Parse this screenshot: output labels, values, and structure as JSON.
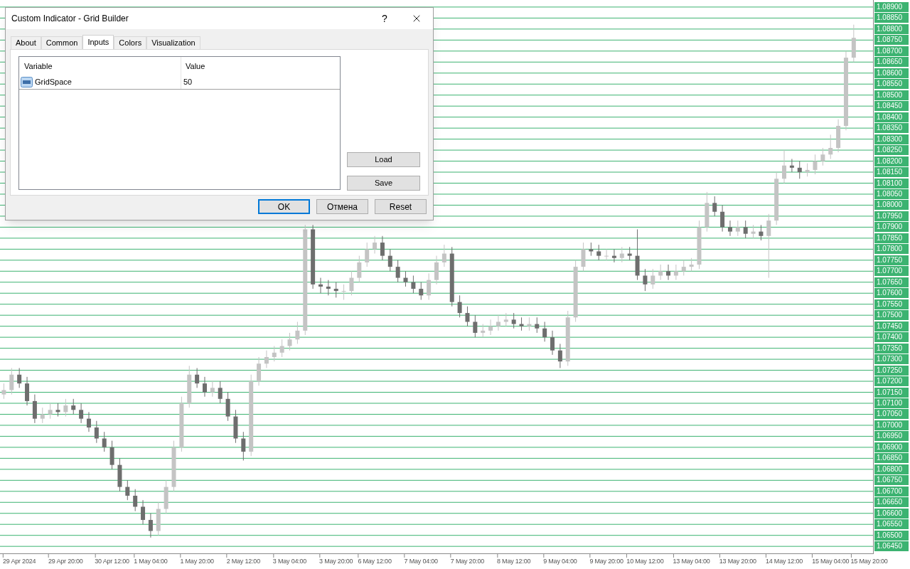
{
  "chart": {
    "chart_data": {
      "type": "candlestick",
      "grid": true,
      "ylim": [
        1.06415,
        1.08932
      ],
      "categories": [
        null,
        null,
        "29 Apr 2024",
        null,
        null,
        null,
        null,
        null,
        "29 Apr 20:00",
        null,
        null,
        null,
        null,
        null,
        "30 Apr 12:00",
        null,
        null,
        null,
        null,
        "1 May 04:00",
        null,
        null,
        null,
        null,
        null,
        "1 May 20:00",
        null,
        null,
        null,
        null,
        null,
        "2 May 12:00",
        null,
        null,
        null,
        null,
        null,
        "3 May 04:00",
        null,
        null,
        null,
        null,
        null,
        "3 May 20:00",
        null,
        null,
        null,
        null,
        "6 May 12:00",
        null,
        null,
        null,
        null,
        null,
        "7 May 04:00",
        null,
        null,
        null,
        null,
        null,
        "7 May 20:00",
        null,
        null,
        null,
        null,
        null,
        "8 May 12:00",
        null,
        null,
        null,
        null,
        null,
        "9 May 04:00",
        null,
        null,
        null,
        null,
        null,
        "9 May 20:00",
        null,
        null,
        null,
        null,
        "10 May 12:00",
        null,
        null,
        null,
        null,
        null,
        "13 May 04:00",
        null,
        null,
        null,
        null,
        null,
        "13 May 20:00",
        null,
        null,
        null,
        null,
        null,
        "14 May 12:00",
        null,
        null,
        null,
        null,
        null,
        "15 May 04:00",
        null,
        null,
        null,
        null,
        "15 May 20:00"
      ],
      "ohlc": [
        [
          1.0714,
          1.0719,
          1.0712,
          1.0716
        ],
        [
          1.0716,
          1.0726,
          1.0714,
          1.0723
        ],
        [
          1.0723,
          1.0726,
          1.0717,
          1.0719
        ],
        [
          1.0719,
          1.0722,
          1.0709,
          1.0711
        ],
        [
          1.0711,
          1.0714,
          1.0701,
          1.0703
        ],
        [
          1.0703,
          1.0708,
          1.0701,
          1.0705
        ],
        [
          1.0705,
          1.071,
          1.0703,
          1.0707
        ],
        [
          1.0707,
          1.071,
          1.0704,
          1.0706
        ],
        [
          1.0706,
          1.0712,
          1.0704,
          1.0709
        ],
        [
          1.0709,
          1.0712,
          1.0705,
          1.0707
        ],
        [
          1.0707,
          1.071,
          1.0701,
          1.0703
        ],
        [
          1.0703,
          1.0706,
          1.0697,
          1.0699
        ],
        [
          1.0699,
          1.0702,
          1.0692,
          1.0694
        ],
        [
          1.0694,
          1.0697,
          1.0688,
          1.069
        ],
        [
          1.069,
          1.0693,
          1.068,
          1.0682
        ],
        [
          1.0682,
          1.0685,
          1.067,
          1.0672
        ],
        [
          1.0672,
          1.0675,
          1.0666,
          1.0668
        ],
        [
          1.0668,
          1.0671,
          1.0661,
          1.0663
        ],
        [
          1.0663,
          1.0666,
          1.0655,
          1.0657
        ],
        [
          1.0657,
          1.066,
          1.0649,
          1.0652
        ],
        [
          1.0652,
          1.0665,
          1.065,
          1.0662
        ],
        [
          1.0662,
          1.0675,
          1.066,
          1.0672
        ],
        [
          1.0672,
          1.0693,
          1.067,
          1.069
        ],
        [
          1.069,
          1.0713,
          1.0688,
          1.071
        ],
        [
          1.071,
          1.0727,
          1.0708,
          1.0723
        ],
        [
          1.0723,
          1.0726,
          1.0717,
          1.0719
        ],
        [
          1.0719,
          1.0722,
          1.0713,
          1.0715
        ],
        [
          1.0715,
          1.072,
          1.0713,
          1.0717
        ],
        [
          1.0717,
          1.072,
          1.071,
          1.0712
        ],
        [
          1.0712,
          1.0715,
          1.0702,
          1.0704
        ],
        [
          1.0704,
          1.0707,
          1.0692,
          1.0694
        ],
        [
          1.0694,
          1.0697,
          1.0684,
          1.0688
        ],
        [
          1.0688,
          1.0723,
          1.0686,
          1.072
        ],
        [
          1.072,
          1.0731,
          1.0718,
          1.0728
        ],
        [
          1.0728,
          1.0734,
          1.0726,
          1.0731
        ],
        [
          1.0731,
          1.0736,
          1.0729,
          1.0733
        ],
        [
          1.0733,
          1.0739,
          1.0731,
          1.0736
        ],
        [
          1.0736,
          1.0742,
          1.0734,
          1.0739
        ],
        [
          1.0739,
          1.0747,
          1.0737,
          1.0743
        ],
        [
          1.0743,
          1.0791,
          1.0741,
          1.0789
        ],
        [
          1.0789,
          1.0791,
          1.0762,
          1.0764
        ],
        [
          1.0764,
          1.0767,
          1.076,
          1.0763
        ],
        [
          1.0763,
          1.0766,
          1.0759,
          1.0762
        ],
        [
          1.0762,
          1.0765,
          1.0758,
          1.0761
        ],
        [
          1.0761,
          1.0764,
          1.0757,
          1.0761
        ],
        [
          1.0761,
          1.077,
          1.0759,
          1.0767
        ],
        [
          1.0767,
          1.0777,
          1.0765,
          1.0774
        ],
        [
          1.0774,
          1.0783,
          1.0772,
          1.078
        ],
        [
          1.078,
          1.0786,
          1.0778,
          1.0783
        ],
        [
          1.0783,
          1.0786,
          1.0775,
          1.0777
        ],
        [
          1.0777,
          1.078,
          1.077,
          1.0772
        ],
        [
          1.0772,
          1.0775,
          1.0765,
          1.0767
        ],
        [
          1.0767,
          1.077,
          1.0763,
          1.0765
        ],
        [
          1.0765,
          1.0768,
          1.076,
          1.0762
        ],
        [
          1.0762,
          1.0765,
          1.0757,
          1.0759
        ],
        [
          1.0759,
          1.0769,
          1.0757,
          1.0766
        ],
        [
          1.0766,
          1.0777,
          1.0764,
          1.0774
        ],
        [
          1.0774,
          1.0782,
          1.0772,
          1.0778
        ],
        [
          1.0778,
          1.0781,
          1.0754,
          1.0756
        ],
        [
          1.0756,
          1.0759,
          1.0749,
          1.0751
        ],
        [
          1.0751,
          1.0754,
          1.0745,
          1.0747
        ],
        [
          1.0747,
          1.075,
          1.074,
          1.0742
        ],
        [
          1.0742,
          1.0746,
          1.074,
          1.0743
        ],
        [
          1.0743,
          1.0748,
          1.0741,
          1.0745
        ],
        [
          1.0745,
          1.075,
          1.0743,
          1.0747
        ],
        [
          1.0747,
          1.0751,
          1.0745,
          1.0748
        ],
        [
          1.0748,
          1.0751,
          1.0744,
          1.0746
        ],
        [
          1.0746,
          1.0749,
          1.0743,
          1.0745
        ],
        [
          1.0745,
          1.0749,
          1.0743,
          1.0746
        ],
        [
          1.0746,
          1.0749,
          1.0742,
          1.0744
        ],
        [
          1.0744,
          1.0747,
          1.0738,
          1.074
        ],
        [
          1.074,
          1.0743,
          1.0732,
          1.0734
        ],
        [
          1.0734,
          1.0737,
          1.0726,
          1.0729
        ],
        [
          1.0729,
          1.0752,
          1.0727,
          1.0749
        ],
        [
          1.0749,
          1.0775,
          1.0747,
          1.0772
        ],
        [
          1.0772,
          1.0783,
          1.077,
          1.078
        ],
        [
          1.078,
          1.0783,
          1.0777,
          1.0779
        ],
        [
          1.0779,
          1.0782,
          1.0775,
          1.0777
        ],
        [
          1.0777,
          1.078,
          1.0775,
          1.0777
        ],
        [
          1.0777,
          1.078,
          1.0774,
          1.0776
        ],
        [
          1.0776,
          1.0781,
          1.0774,
          1.0778
        ],
        [
          1.0778,
          1.0781,
          1.0775,
          1.0777
        ],
        [
          1.0777,
          1.0789,
          1.0766,
          1.0768
        ],
        [
          1.0768,
          1.0771,
          1.0761,
          1.0764
        ],
        [
          1.0764,
          1.0771,
          1.0762,
          1.0768
        ],
        [
          1.0768,
          1.0773,
          1.0766,
          1.077
        ],
        [
          1.077,
          1.0773,
          1.0766,
          1.0768
        ],
        [
          1.0768,
          1.0773,
          1.0766,
          1.077
        ],
        [
          1.077,
          1.0775,
          1.0768,
          1.0772
        ],
        [
          1.0772,
          1.0776,
          1.077,
          1.0773
        ],
        [
          1.0773,
          1.0793,
          1.0771,
          1.079
        ],
        [
          1.079,
          1.0806,
          1.0788,
          1.0801
        ],
        [
          1.0801,
          1.0804,
          1.0795,
          1.0797
        ],
        [
          1.0797,
          1.08,
          1.0788,
          1.079
        ],
        [
          1.079,
          1.0793,
          1.0786,
          1.0788
        ],
        [
          1.0788,
          1.0793,
          1.0786,
          1.079
        ],
        [
          1.079,
          1.0793,
          1.0785,
          1.0787
        ],
        [
          1.0787,
          1.0791,
          1.0785,
          1.0788
        ],
        [
          1.0788,
          1.0791,
          1.0784,
          1.0786
        ],
        [
          1.0786,
          1.0796,
          1.0767,
          1.0793
        ],
        [
          1.0793,
          1.0815,
          1.0791,
          1.0812
        ],
        [
          1.0812,
          1.0825,
          1.081,
          1.0818
        ],
        [
          1.0818,
          1.0821,
          1.0815,
          1.0817
        ],
        [
          1.0817,
          1.082,
          1.0812,
          1.0815
        ],
        [
          1.0815,
          1.0819,
          1.0813,
          1.0816
        ],
        [
          1.0816,
          1.0823,
          1.0814,
          1.082
        ],
        [
          1.082,
          1.0826,
          1.0818,
          1.0823
        ],
        [
          1.0823,
          1.0832,
          1.0821,
          1.0826
        ],
        [
          1.0826,
          1.0839,
          1.0824,
          1.0836
        ],
        [
          1.0836,
          1.087,
          1.0834,
          1.0867
        ],
        [
          1.0867,
          1.0882,
          1.0865,
          1.0876
        ],
        null,
        null
      ],
      "yticks": [
        {
          "value": 1.089,
          "label": "1.08900"
        },
        {
          "value": 1.0885,
          "label": "1.08850"
        },
        {
          "value": 1.088,
          "label": "1.08800"
        },
        {
          "value": 1.0875,
          "label": "1.08750"
        },
        {
          "value": 1.087,
          "label": "1.08700"
        },
        {
          "value": 1.0865,
          "label": "1.08650"
        },
        {
          "value": 1.086,
          "label": "1.08600"
        },
        {
          "value": 1.0855,
          "label": "1.08550"
        },
        {
          "value": 1.085,
          "label": "1.08500"
        },
        {
          "value": 1.0845,
          "label": "1.08450"
        },
        {
          "value": 1.084,
          "label": "1.08400"
        },
        {
          "value": 1.0835,
          "label": "1.08350"
        },
        {
          "value": 1.083,
          "label": "1.08300"
        },
        {
          "value": 1.0825,
          "label": "1.08250"
        },
        {
          "value": 1.082,
          "label": "1.08200"
        },
        {
          "value": 1.0815,
          "label": "1.08150"
        },
        {
          "value": 1.081,
          "label": "1.08100"
        },
        {
          "value": 1.0805,
          "label": "1.08050"
        },
        {
          "value": 1.08,
          "label": "1.08000"
        },
        {
          "value": 1.0795,
          "label": "1.07950"
        },
        {
          "value": 1.079,
          "label": "1.07900"
        },
        {
          "value": 1.0785,
          "label": "1.07850"
        },
        {
          "value": 1.078,
          "label": "1.07800"
        },
        {
          "value": 1.0775,
          "label": "1.07750"
        },
        {
          "value": 1.077,
          "label": "1.07700"
        },
        {
          "value": 1.0765,
          "label": "1.07650"
        },
        {
          "value": 1.076,
          "label": "1.07600"
        },
        {
          "value": 1.0755,
          "label": "1.07550"
        },
        {
          "value": 1.075,
          "label": "1.07500"
        },
        {
          "value": 1.0745,
          "label": "1.07450"
        },
        {
          "value": 1.074,
          "label": "1.07400"
        },
        {
          "value": 1.0735,
          "label": "1.07350"
        },
        {
          "value": 1.073,
          "label": "1.07300"
        },
        {
          "value": 1.0725,
          "label": "1.07250"
        },
        {
          "value": 1.072,
          "label": "1.07200"
        },
        {
          "value": 1.0715,
          "label": "1.07150"
        },
        {
          "value": 1.071,
          "label": "1.07100"
        },
        {
          "value": 1.0705,
          "label": "1.07050"
        },
        {
          "value": 1.07,
          "label": "1.07000"
        },
        {
          "value": 1.0695,
          "label": "1.06950"
        },
        {
          "value": 1.069,
          "label": "1.06900"
        },
        {
          "value": 1.0685,
          "label": "1.06850"
        },
        {
          "value": 1.068,
          "label": "1.06800"
        },
        {
          "value": 1.0675,
          "label": "1.06750"
        },
        {
          "value": 1.067,
          "label": "1.06700"
        },
        {
          "value": 1.0665,
          "label": "1.06650"
        },
        {
          "value": 1.066,
          "label": "1.06600"
        },
        {
          "value": 1.0655,
          "label": "1.06550"
        },
        {
          "value": 1.065,
          "label": "1.06500"
        },
        {
          "value": 1.0645,
          "label": "1.06450"
        }
      ]
    }
  },
  "dialog": {
    "title": "Custom Indicator - Grid Builder",
    "help": "?",
    "tabs": [
      {
        "label": "About",
        "selected": false
      },
      {
        "label": "Common",
        "selected": false
      },
      {
        "label": "Inputs",
        "selected": true
      },
      {
        "label": "Colors",
        "selected": false
      },
      {
        "label": "Visualization",
        "selected": false
      }
    ],
    "table": {
      "columns": [
        "Variable",
        "Value"
      ],
      "rows": [
        {
          "variable": "GridSpace",
          "value": "50"
        }
      ]
    },
    "side_buttons": [
      "Load",
      "Save"
    ],
    "buttons": [
      {
        "label": "OK",
        "default": true
      },
      {
        "label": "Отмена",
        "default": false
      },
      {
        "label": "Reset",
        "default": false
      }
    ]
  }
}
